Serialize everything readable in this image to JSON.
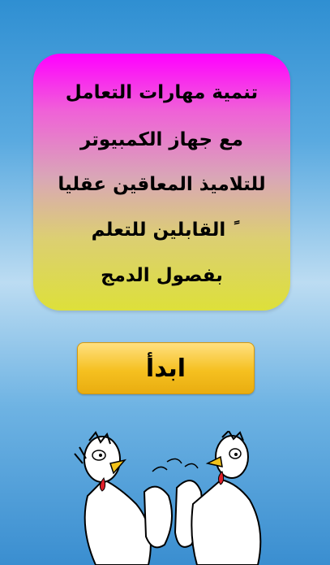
{
  "title": {
    "lines": [
      "تنمية مهارات التعامل",
      "مع جهاز الكمبيوتر",
      "للتلاميذ المعاقين عقليا",
      "ً القابلين للتعلم",
      "بفصول الدمج"
    ]
  },
  "start_button": {
    "label": "ابدأ"
  },
  "illustration": {
    "name": "clapping-chickens",
    "description_icon": "chickens-cartoon"
  },
  "colors": {
    "card_top": "#ff00ff",
    "card_bottom": "#dde03a",
    "button": "#f5c020",
    "background": "#5aaae0"
  }
}
